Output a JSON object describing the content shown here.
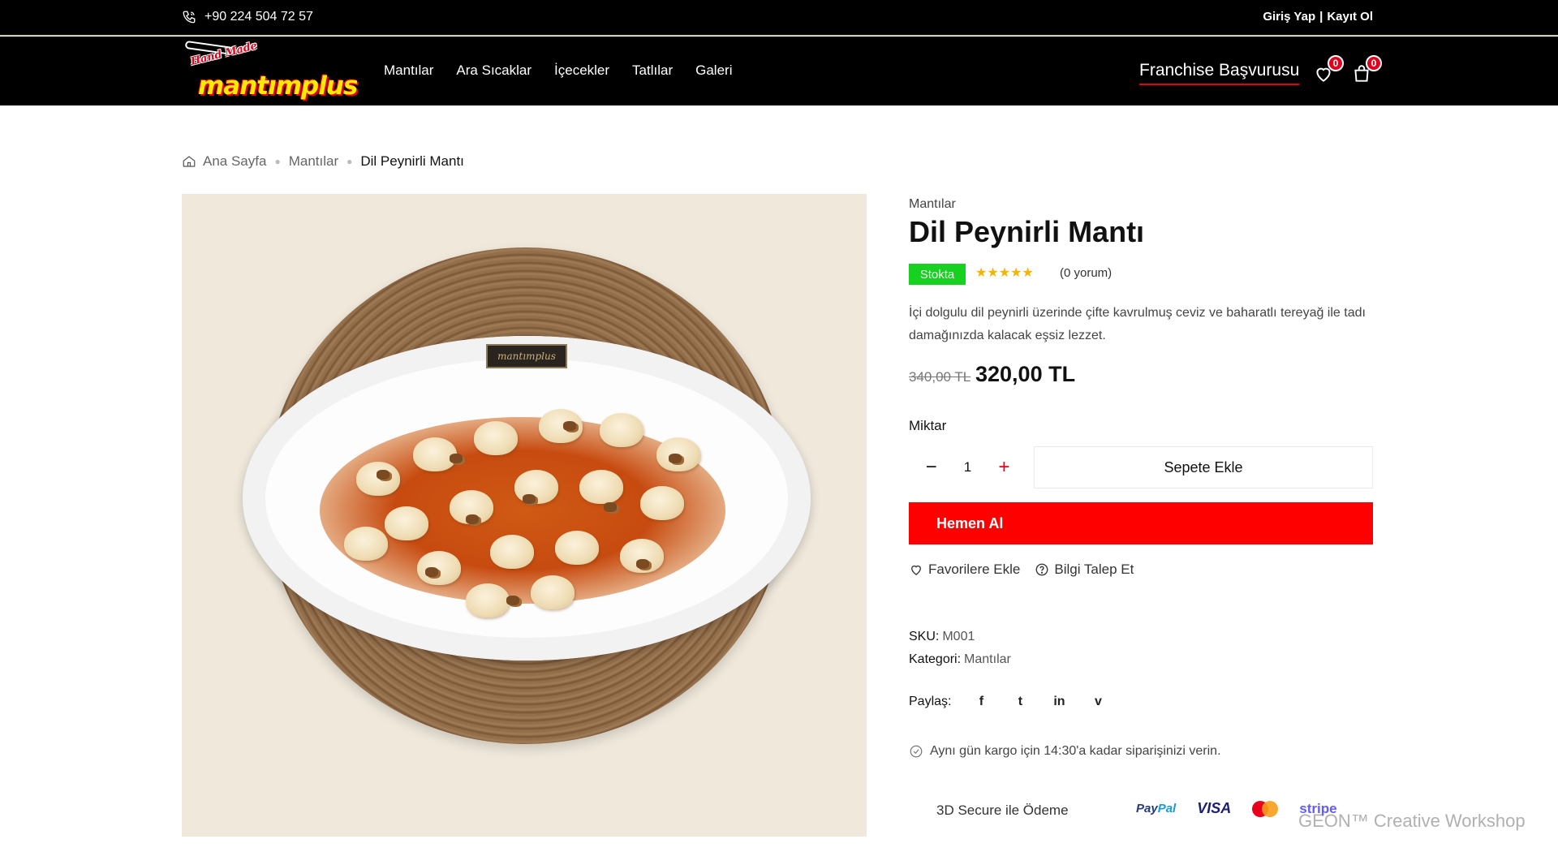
{
  "topbar": {
    "phone": "+90 224 504 72 57",
    "login": "Giriş Yap",
    "separator": "|",
    "register": "Kayıt Ol"
  },
  "header": {
    "logo": {
      "script": "Hand Made",
      "word": "mantımplus"
    },
    "nav": [
      "Mantılar",
      "Ara Sıcaklar",
      "İçecekler",
      "Tatlılar",
      "Galeri"
    ],
    "franchise": "Franchise Başvurusu",
    "wishlist_count": "0",
    "cart_count": "0",
    "accent_color": "#e3001b"
  },
  "breadcrumb": {
    "home": "Ana Sayfa",
    "category": "Mantılar",
    "current": "Dil Peynirli Mantı"
  },
  "product": {
    "image_alt": "Dil Peynirli Mantı",
    "plate_brand": "mantımplus",
    "category": "Mantılar",
    "title": "Dil Peynirli Mantı",
    "stock": "Stokta",
    "rating": "★★★★★",
    "reviews": "(0 yorum)",
    "description": "İçi dolgulu dil peynirli üzerinde çifte kavrulmuş ceviz ve baharatlı tereyağ ile tadı damağınızda kalacak eşsiz lezzet.",
    "price_old": "340,00 TL",
    "price_new": "320,00 TL",
    "qty_label": "Miktar",
    "qty_minus": "−",
    "qty_value": "1",
    "qty_plus": "+",
    "add_to_cart": "Sepete Ekle",
    "buy_now": "Hemen Al",
    "add_favorite": "Favorilere Ekle",
    "request_info": "Bilgi Talep Et",
    "sku_label": "SKU:",
    "sku_value": "M001",
    "category_label": "Kategori:",
    "category_value": "Mantılar",
    "share_label": "Paylaş:",
    "share_icons": [
      "f",
      "t",
      "in",
      "v"
    ],
    "shipping_note": "Aynı gün kargo için 14:30'a kadar siparişinizi verin.",
    "secure_payment": "3D Secure ile Ödeme",
    "payments": {
      "paypal_a": "Pay",
      "paypal_b": "Pal",
      "visa": "VISA",
      "stripe": "stripe"
    },
    "buy_color": "#ff0000",
    "stock_color": "#16d11f"
  },
  "watermark": "GEON™ Creative Workshop"
}
